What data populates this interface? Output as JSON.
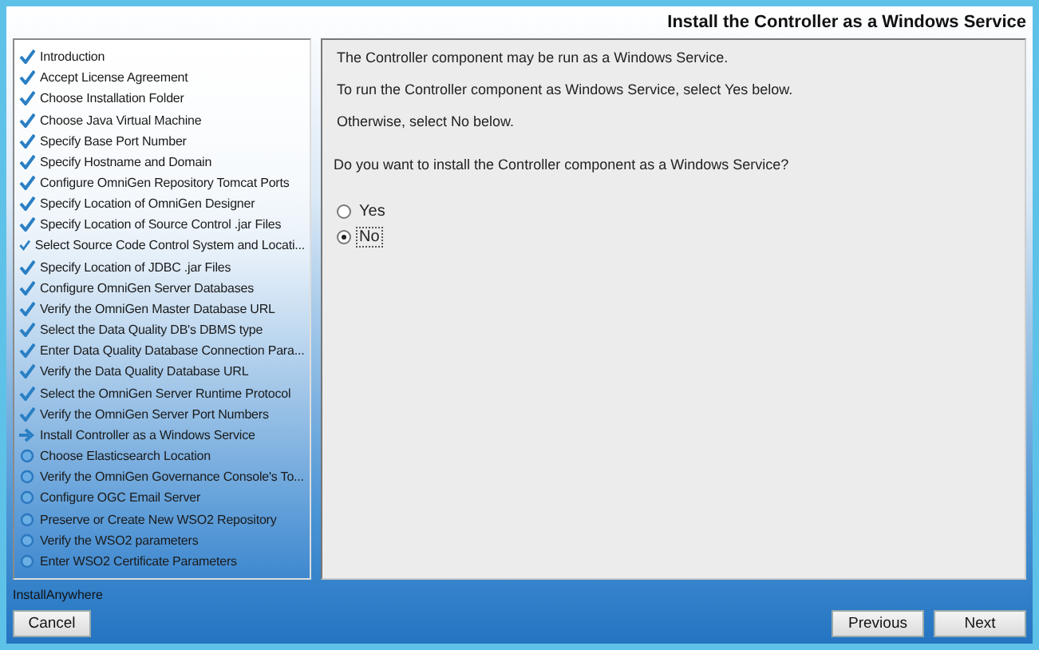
{
  "header": {
    "title": "Install the Controller as a Windows Service"
  },
  "steps": [
    {
      "label": "Introduction",
      "kind": "done"
    },
    {
      "label": "Accept License Agreement",
      "kind": "done"
    },
    {
      "label": "Choose Installation Folder",
      "kind": "done"
    },
    {
      "label": "Choose Java Virtual Machine",
      "kind": "done"
    },
    {
      "label": "Specify Base Port Number",
      "kind": "done"
    },
    {
      "label": "Specify Hostname and Domain",
      "kind": "done"
    },
    {
      "label": "Configure OmniGen Repository Tomcat Ports",
      "kind": "done"
    },
    {
      "label": "Specify Location of OmniGen Designer",
      "kind": "done"
    },
    {
      "label": "Specify Location of Source Control .jar Files",
      "kind": "done"
    },
    {
      "label": "Select Source Code Control System and Locati...",
      "kind": "done"
    },
    {
      "label": "Specify Location of JDBC  .jar Files",
      "kind": "done"
    },
    {
      "label": "Configure OmniGen Server Databases",
      "kind": "done"
    },
    {
      "label": "Verify the OmniGen Master Database URL",
      "kind": "done"
    },
    {
      "label": "Select the Data Quality DB's DBMS type",
      "kind": "done"
    },
    {
      "label": "Enter Data Quality Database Connection Para...",
      "kind": "done"
    },
    {
      "label": "Verify the Data Quality Database URL",
      "kind": "done"
    },
    {
      "label": "Select the OmniGen Server Runtime Protocol",
      "kind": "done"
    },
    {
      "label": "Verify the OmniGen Server Port Numbers",
      "kind": "done"
    },
    {
      "label": "Install Controller as a Windows Service",
      "kind": "current"
    },
    {
      "label": "Choose Elasticsearch Location",
      "kind": "pending"
    },
    {
      "label": "Verify the OmniGen Governance Console's To...",
      "kind": "pending"
    },
    {
      "label": "Configure OGC Email Server",
      "kind": "pending"
    },
    {
      "label": "Preserve or Create New WSO2 Repository",
      "kind": "pending"
    },
    {
      "label": "Verify the WSO2 parameters",
      "kind": "pending"
    },
    {
      "label": "Enter WSO2 Certificate Parameters",
      "kind": "pending"
    }
  ],
  "content": {
    "paragraphs": [
      "The Controller component may be run as a Windows Service.",
      "To run the Controller component as Windows Service, select Yes below.",
      "Otherwise, select No below."
    ],
    "question": "Do you want to install the Controller component as a Windows Service?",
    "options": [
      {
        "label": "Yes",
        "selected": false
      },
      {
        "label": "No",
        "selected": true
      }
    ]
  },
  "footer": {
    "brand": "InstallAnywhere",
    "buttons": [
      {
        "label": "Cancel",
        "kind": "cancel"
      },
      {
        "label": "Previous",
        "kind": "nav"
      },
      {
        "label": "Next",
        "kind": "nav"
      }
    ]
  }
}
